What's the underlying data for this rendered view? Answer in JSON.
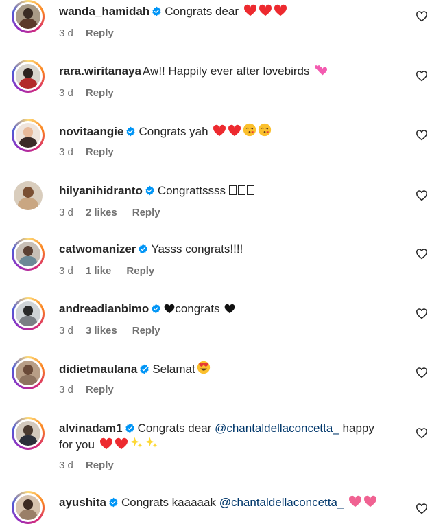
{
  "colors": {
    "text": "#262626",
    "meta": "#737373",
    "mention": "#00376b",
    "verified": "#0095f6",
    "heart_red": "#ed2a2f"
  },
  "comments": [
    {
      "username": "wanda_hamidah",
      "verified": true,
      "text": "Congrats dear",
      "emojis": [
        "red-heart",
        "red-heart",
        "red-heart"
      ],
      "time": "3 d",
      "likes": "",
      "reply": "Reply"
    },
    {
      "username": "rara.wiritanaya",
      "verified": false,
      "text": "Aw!! Happily ever after lovebirds",
      "emojis": [
        "two-hearts"
      ],
      "time": "3 d",
      "likes": "",
      "reply": "Reply"
    },
    {
      "username": "novitaangie",
      "verified": true,
      "text": "Congrats yah",
      "emojis": [
        "red-heart",
        "red-heart",
        "kiss-face",
        "kiss-face"
      ],
      "time": "3 d",
      "likes": "",
      "reply": "Reply"
    },
    {
      "username": "hilyanihidranto",
      "verified": true,
      "text": "Congrattssss",
      "emojis": [
        "missing-glyph",
        "missing-glyph",
        "missing-glyph"
      ],
      "time": "3 d",
      "likes": "2 likes",
      "reply": "Reply"
    },
    {
      "username": "catwomanizer",
      "verified": true,
      "text": "Yasss congrats!!!!",
      "emojis": [],
      "time": "3 d",
      "likes": "1 like",
      "reply": "Reply"
    },
    {
      "username": "andreadianbimo",
      "verified": true,
      "text": "congrats",
      "emojis": [
        "black-heart-before",
        "black-heart"
      ],
      "time": "3 d",
      "likes": "3 likes",
      "reply": "Reply"
    },
    {
      "username": "didietmaulana",
      "verified": true,
      "text": "Selamat",
      "emojis": [
        "heart-eyes"
      ],
      "time": "3 d",
      "likes": "",
      "reply": "Reply"
    },
    {
      "username": "alvinadam1",
      "verified": true,
      "text": "Congrats dear",
      "mention": "@chantaldellaconcetta_",
      "text_after": "happy",
      "line2": "for you",
      "emojis": [
        "red-heart",
        "red-heart",
        "sparkles",
        "sparkles"
      ],
      "time": "3 d",
      "likes": "",
      "reply": "Reply"
    },
    {
      "username": "ayushita",
      "verified": true,
      "text": "Congrats kaaaaak",
      "mention": "@chantaldellaconcetta_",
      "emojis": [
        "pink-heart",
        "pink-heart"
      ],
      "time": "",
      "likes": "",
      "reply": ""
    }
  ]
}
